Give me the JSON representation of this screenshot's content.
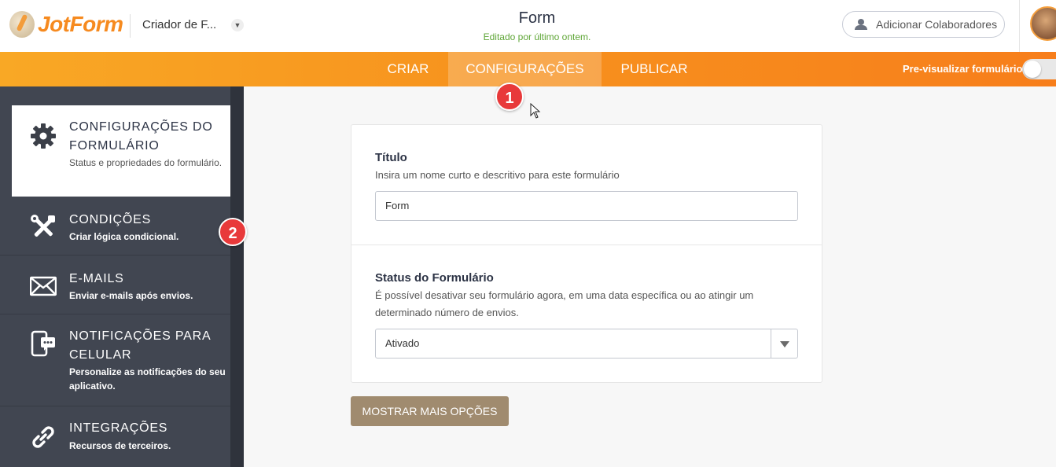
{
  "header": {
    "logo_text": "JotForm",
    "workspace": "Criador de F...",
    "form_title": "Form",
    "form_subtitle": "Editado por último ontem.",
    "collab_label": "Adicionar Colaboradores"
  },
  "nav": {
    "tabs": [
      {
        "label": "CRIAR"
      },
      {
        "label": "CONFIGURAÇÕES"
      },
      {
        "label": "PUBLICAR"
      }
    ],
    "preview_label": "Pre-visualizar formulário"
  },
  "sidebar": {
    "items": [
      {
        "title": "CONFIGURAÇÕES DO FORMULÁRIO",
        "desc": "Status e propriedades do formulário.",
        "icon": "gear-icon"
      },
      {
        "title": "CONDIÇÕES",
        "desc": "Criar lógica condicional.",
        "icon": "tools-icon"
      },
      {
        "title": "E-MAILS",
        "desc": "Enviar e-mails após envios.",
        "icon": "envelope-icon"
      },
      {
        "title": "NOTIFICAÇÕES PARA CELULAR",
        "desc": "Personalize as notificações do seu aplicativo.",
        "icon": "mobile-notification-icon"
      },
      {
        "title": "INTEGRAÇÕES",
        "desc": "Recursos de terceiros.",
        "icon": "link-icon"
      }
    ]
  },
  "main": {
    "title_label": "Título",
    "title_help": "Insira um nome curto e descritivo para este formulário",
    "title_value": "Form",
    "status_label": "Status do Formulário",
    "status_help": "É possível desativar seu formulário agora, em uma data específica ou ao atingir um determinado número de envios.",
    "status_value": "Ativado",
    "more_button": "MOSTRAR MAIS OPÇÕES"
  },
  "annotations": {
    "badge1": "1",
    "badge2": "2"
  },
  "colors": {
    "brand_orange": "#f7931e",
    "sidebar_bg": "#414651",
    "button_tan": "#a08b6f",
    "badge_red": "#e8393a",
    "subtitle_green": "#5fa637"
  }
}
